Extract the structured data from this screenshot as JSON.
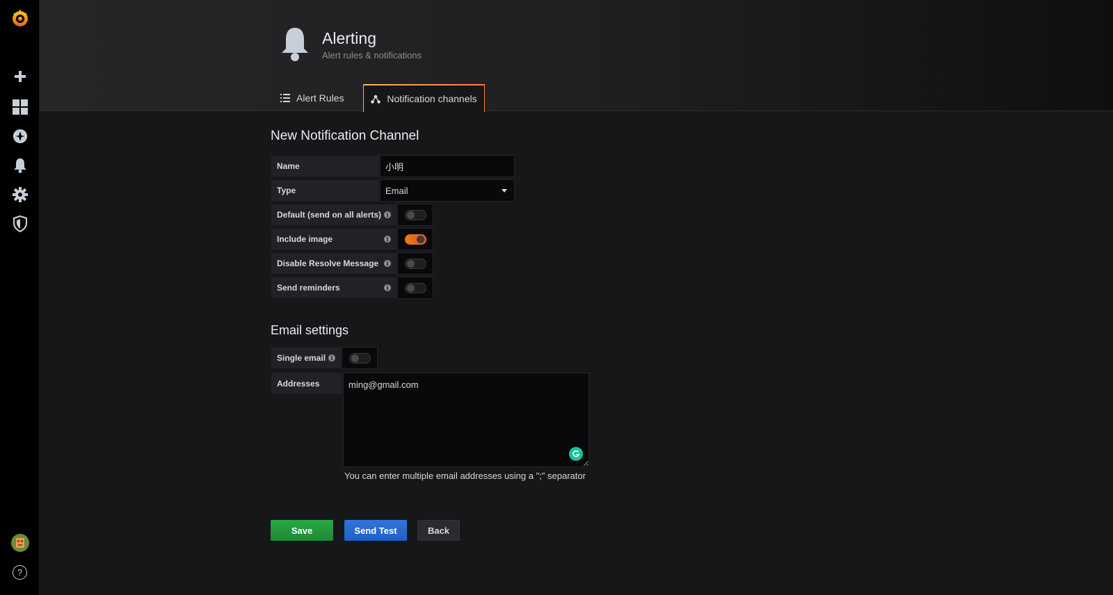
{
  "header": {
    "title": "Alerting",
    "subtitle": "Alert rules & notifications",
    "tabs": [
      {
        "label": "Alert Rules"
      },
      {
        "label": "Notification channels"
      }
    ]
  },
  "sidebar": {
    "icons": [
      "grafana-logo",
      "plus-icon",
      "dashboards-icon",
      "explore-icon",
      "alert-bell-icon",
      "gear-icon",
      "shield-icon",
      "avatar",
      "help-icon"
    ],
    "help_glyph": "?"
  },
  "form": {
    "title": "New Notification Channel",
    "name_label": "Name",
    "name_value": "小明",
    "type_label": "Type",
    "type_value": "Email",
    "toggles": [
      {
        "label": "Default (send on all alerts)",
        "on": false
      },
      {
        "label": "Include image",
        "on": true
      },
      {
        "label": "Disable Resolve Message",
        "on": false
      },
      {
        "label": "Send reminders",
        "on": false
      }
    ],
    "info_glyph": "i"
  },
  "email": {
    "title": "Email settings",
    "single_label": "Single email",
    "single_on": false,
    "addresses_label": "Addresses",
    "addresses_value": "ming@gmail.com",
    "hint": "You can enter multiple email addresses using a \";\" separator"
  },
  "buttons": {
    "save": "Save",
    "test": "Send Test",
    "back": "Back"
  },
  "colors": {
    "accent_orange": "#eb7b18",
    "save_green": "#28a745",
    "test_blue": "#3274d9"
  }
}
